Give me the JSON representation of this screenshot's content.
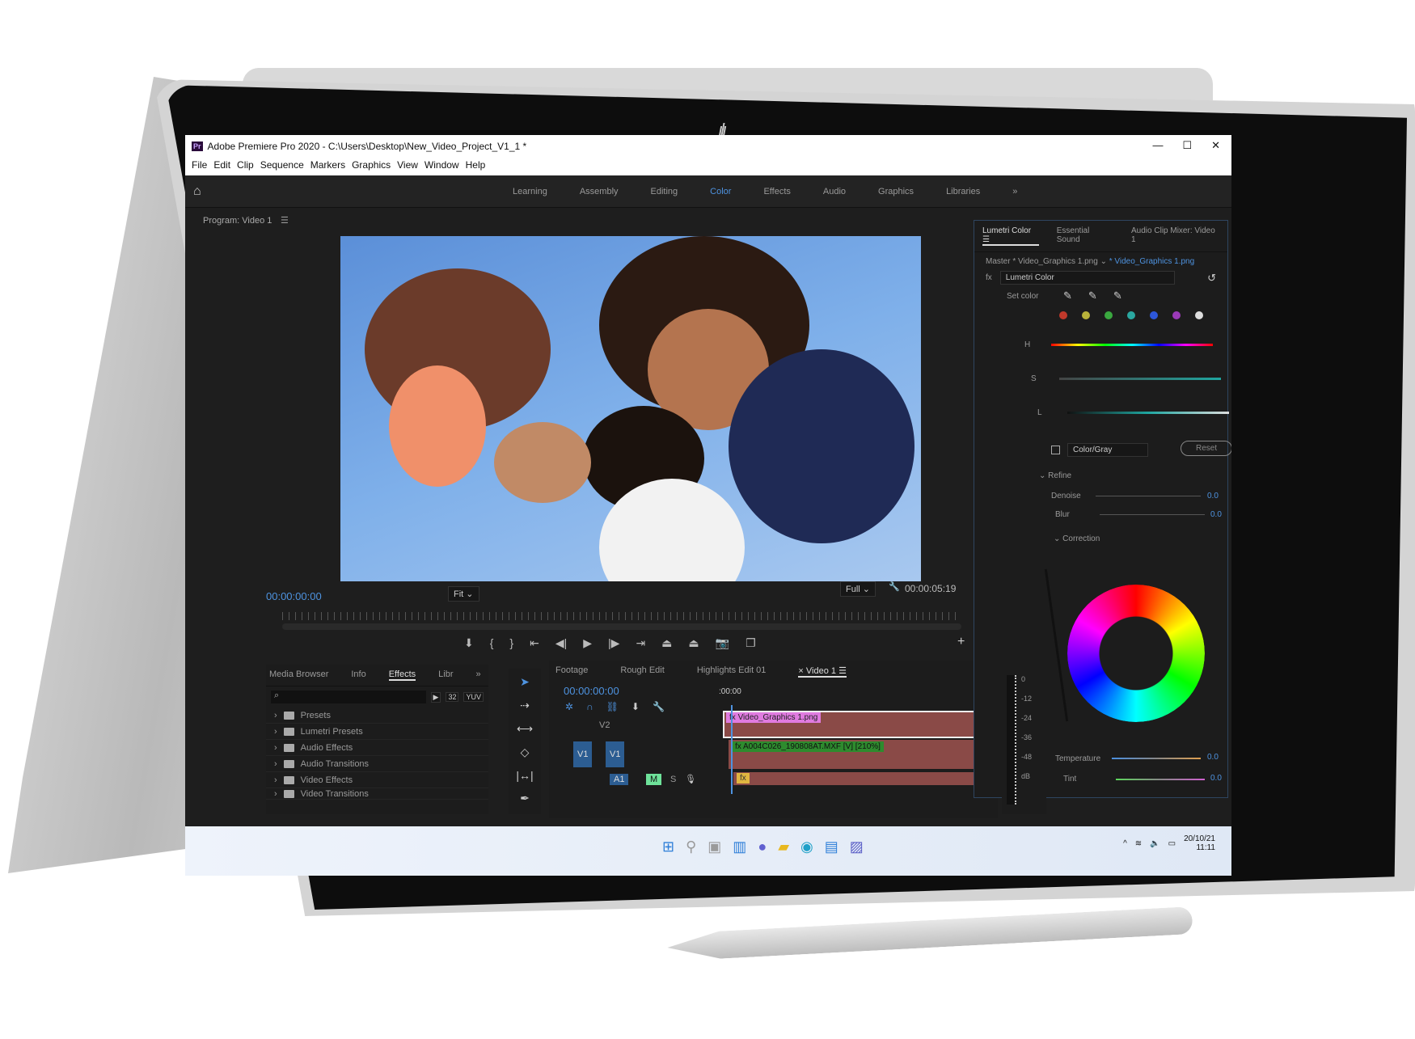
{
  "window": {
    "title": "Adobe Premiere Pro 2020 - C:\\Users\\Desktop\\New_Video_Project_V1_1 *",
    "app_badge": "Pr",
    "controls": [
      "—",
      "☐",
      "✕"
    ]
  },
  "menu": [
    "File",
    "Edit",
    "Clip",
    "Sequence",
    "Markers",
    "Graphics",
    "View",
    "Window",
    "Help"
  ],
  "workspaces": {
    "items": [
      "Learning",
      "Assembly",
      "Editing",
      "Color",
      "Effects",
      "Audio",
      "Graphics",
      "Libraries"
    ],
    "active": "Color",
    "more": "»"
  },
  "program": {
    "label": "Program: Video 1",
    "timecode": "00:00:00:00",
    "fit": "Fit",
    "quality": "Full",
    "duration": "00:00:05:19"
  },
  "project_panel": {
    "tabs": [
      "Media Browser",
      "Info",
      "Effects",
      "Libr"
    ],
    "active": "Effects",
    "more": "»",
    "search_placeholder": "",
    "items": [
      "Presets",
      "Lumetri Presets",
      "Audio Effects",
      "Audio Transitions",
      "Video Effects",
      "Video Transitions"
    ],
    "badges": [
      "▶",
      "32",
      "YUV"
    ]
  },
  "timeline": {
    "tabs": [
      "Footage",
      "Rough Edit",
      "Highlights Edit 01",
      "Video 1"
    ],
    "active": "Video 1",
    "timecode": "00:00:00:00",
    "ruler_start": ":00:00",
    "tracks": {
      "v2": "V2",
      "v1": "V1",
      "a1": "A1",
      "m": "M",
      "s": "S"
    },
    "clips": [
      "Video_Graphics 1.png",
      "A004C026_190808AT.MXF [V] [210%]"
    ],
    "fx": "fx"
  },
  "meter": {
    "labels": [
      "0",
      "-12",
      "-24",
      "-36",
      "-48",
      "dB"
    ]
  },
  "lumetri": {
    "tabs": [
      "Lumetri Color",
      "Essential Sound",
      "Audio Clip Mixer: Video 1"
    ],
    "active": "Lumetri Color",
    "master": "Master * Video_Graphics 1.png",
    "clip": "* Video_Graphics 1.png",
    "effect": "Lumetri Color",
    "fx": "fx",
    "set_color": "Set color",
    "swatches": [
      "#c0392b",
      "#b8b23a",
      "#3aa83f",
      "#2aa7a0",
      "#2d57d9",
      "#9b3ab8",
      "#dddddd"
    ],
    "hsl": [
      "H",
      "S",
      "L"
    ],
    "mode": "Color/Gray",
    "reset": "Reset",
    "refine": "Refine",
    "denoise": {
      "label": "Denoise",
      "value": "0.0"
    },
    "blur": {
      "label": "Blur",
      "value": "0.0"
    },
    "correction": "Correction",
    "temperature": {
      "label": "Temperature",
      "value": "0.0"
    },
    "tint": {
      "label": "Tint",
      "value": "0.0"
    }
  },
  "taskbar": {
    "icons": [
      "windows-icon",
      "search-icon",
      "task-view-icon",
      "widgets-icon",
      "chat-icon",
      "explorer-icon",
      "edge-icon",
      "store-icon",
      "teams-icon"
    ],
    "date": "20/10/21",
    "time": "11:11"
  },
  "brand": "hp",
  "colors": {
    "accent": "#4e93e0",
    "clip": "#8a4a47",
    "v2clip": "#e07be0",
    "v1clip": "#2e8b2e"
  }
}
